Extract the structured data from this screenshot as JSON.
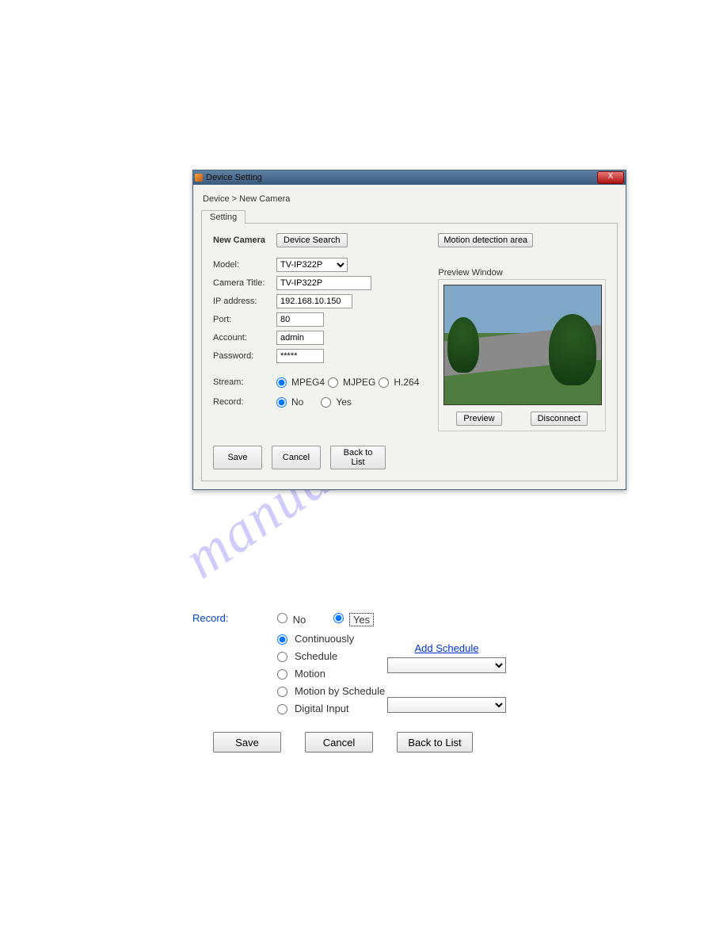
{
  "watermark": "manualshive.com",
  "dialog": {
    "window_title": "Device Setting",
    "close_glyph": "X",
    "breadcrumb": "Device > New Camera",
    "tab": "Setting",
    "heading": "New Camera",
    "device_search_btn": "Device Search",
    "motion_btn": "Motion detection area",
    "fields": {
      "model_label": "Model:",
      "model_value": "TV-IP322P",
      "title_label": "Camera Title:",
      "title_value": "TV-IP322P",
      "ip_label": "IP address:",
      "ip_value": "192.168.10.150",
      "port_label": "Port:",
      "port_value": "80",
      "account_label": "Account:",
      "account_value": "admin",
      "password_label": "Password:",
      "password_value": "*****"
    },
    "stream": {
      "label": "Stream:",
      "opts": [
        "MPEG4",
        "MJPEG",
        "H.264"
      ],
      "selected": "MPEG4"
    },
    "record": {
      "label": "Record:",
      "opts": [
        "No",
        "Yes"
      ],
      "selected": "No"
    },
    "preview": {
      "label": "Preview Window",
      "preview_btn": "Preview",
      "disconnect_btn": "Disconnect"
    },
    "bottom": {
      "save": "Save",
      "cancel": "Cancel",
      "back": "Back to List"
    }
  },
  "record_section": {
    "label": "Record:",
    "no": "No",
    "yes": "Yes",
    "selected": "Yes",
    "modes": [
      "Continuously",
      "Schedule",
      "Motion",
      "Motion by Schedule",
      "Digital Input"
    ],
    "mode_selected": "Continuously",
    "add_schedule": "Add Schedule",
    "save": "Save",
    "cancel": "Cancel",
    "back": "Back to List"
  }
}
